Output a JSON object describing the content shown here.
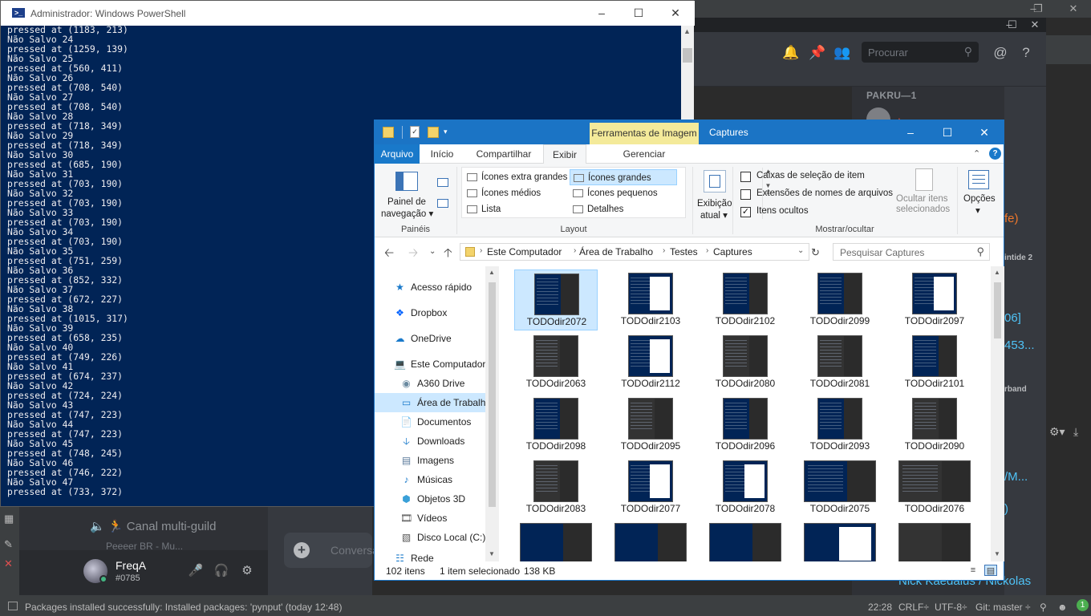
{
  "ide": {
    "status_message": "Packages installed successfully: Installed packages: 'pynput' (today 12:48)",
    "cursor_position": "22:28",
    "line_separator": "CRLF÷",
    "encoding": "UTF-8÷",
    "git_branch": "Git: master ÷",
    "notification_count": "1"
  },
  "discord": {
    "search_placeholder": "Procurar",
    "members_header": "PAKRU—1",
    "peek_texts": [
      "fe)",
      "intide 2",
      "06]",
      "453...",
      "rband",
      "/M...",
      ")",
      "Nick Kaedalus / Nickolas"
    ],
    "channel_name": "Canal multi-guild",
    "channel_sub": "Peeeer BR - Mu...",
    "compose_placeholder": "Conversa",
    "username": "FreqA",
    "user_tag": "#0785"
  },
  "powershell": {
    "title": "Administrador: Windows PowerShell",
    "lines": [
      "pressed at (1183, 213)",
      "Não Salvo 24",
      "pressed at (1259, 139)",
      "Não Salvo 25",
      "pressed at (560, 411)",
      "Não Salvo 26",
      "pressed at (708, 540)",
      "Não Salvo 27",
      "pressed at (708, 540)",
      "Não Salvo 28",
      "pressed at (718, 349)",
      "Não Salvo 29",
      "pressed at (718, 349)",
      "Não Salvo 30",
      "pressed at (685, 190)",
      "Não Salvo 31",
      "pressed at (703, 190)",
      "Não Salvo 32",
      "pressed at (703, 190)",
      "Não Salvo 33",
      "pressed at (703, 190)",
      "Não Salvo 34",
      "pressed at (703, 190)",
      "Não Salvo 35",
      "pressed at (751, 259)",
      "Não Salvo 36",
      "pressed at (852, 332)",
      "Não Salvo 37",
      "pressed at (672, 227)",
      "Não Salvo 38",
      "pressed at (1015, 317)",
      "Não Salvo 39",
      "pressed at (658, 235)",
      "Não Salvo 40",
      "pressed at (749, 226)",
      "Não Salvo 41",
      "pressed at (674, 237)",
      "Não Salvo 42",
      "pressed at (724, 224)",
      "Não Salvo 43",
      "pressed at (747, 223)",
      "Não Salvo 44",
      "pressed at (747, 223)",
      "Não Salvo 45",
      "pressed at (748, 245)",
      "Não Salvo 46",
      "pressed at (746, 222)",
      "Não Salvo 47",
      "pressed at (733, 372)"
    ]
  },
  "explorer": {
    "title": "Captures",
    "tools_tab": "Ferramentas de Imagem",
    "tabs": {
      "file": "Arquivo",
      "home": "Início",
      "share": "Compartilhar",
      "view": "Exibir",
      "manage": "Gerenciar"
    },
    "ribbon": {
      "nav_pane": "Painel de",
      "nav_pane_2": "navegação",
      "group_panes": "Painéis",
      "group_layout": "Layout",
      "group_current": "Exibição",
      "group_current_2": "atual",
      "group_showhide": "Mostrar/ocultar",
      "layout_options": [
        "Ícones extra grandes",
        "Ícones grandes",
        "Ícones médios",
        "Ícones pequenos",
        "Lista",
        "Detalhes"
      ],
      "checkbox_item": "Caixas de seleção de item",
      "checkbox_ext": "Extensões de nomes de arquivos",
      "checkbox_hidden": "Itens ocultos",
      "hide_selected": "Ocultar itens",
      "hide_selected_2": "selecionados",
      "options": "Opções"
    },
    "breadcrumb": [
      "Este Computador",
      "Área de Trabalho",
      "Testes",
      "Captures"
    ],
    "search_placeholder": "Pesquisar Captures",
    "nav_items": [
      "Acesso rápido",
      "Dropbox",
      "OneDrive",
      "Este Computador",
      "A360 Drive",
      "Área de Trabalho",
      "Documentos",
      "Downloads",
      "Imagens",
      "Músicas",
      "Objetos 3D",
      "Vídeos",
      "Disco Local (C:)",
      "Rede"
    ],
    "files": [
      "TODOdir2072",
      "TODOdir2103",
      "TODOdir2102",
      "TODOdir2099",
      "TODOdir2097",
      "TODOdir2063",
      "TODOdir2112",
      "TODOdir2080",
      "TODOdir2081",
      "TODOdir2101",
      "TODOdir2098",
      "TODOdir2095",
      "TODOdir2096",
      "TODOdir2093",
      "TODOdir2090",
      "TODOdir2083",
      "TODOdir2077",
      "TODOdir2078",
      "TODOdir2075",
      "TODOdir2076"
    ],
    "status_count": "102 itens",
    "status_selected": "1 item selecionado",
    "status_size": "138 KB"
  }
}
